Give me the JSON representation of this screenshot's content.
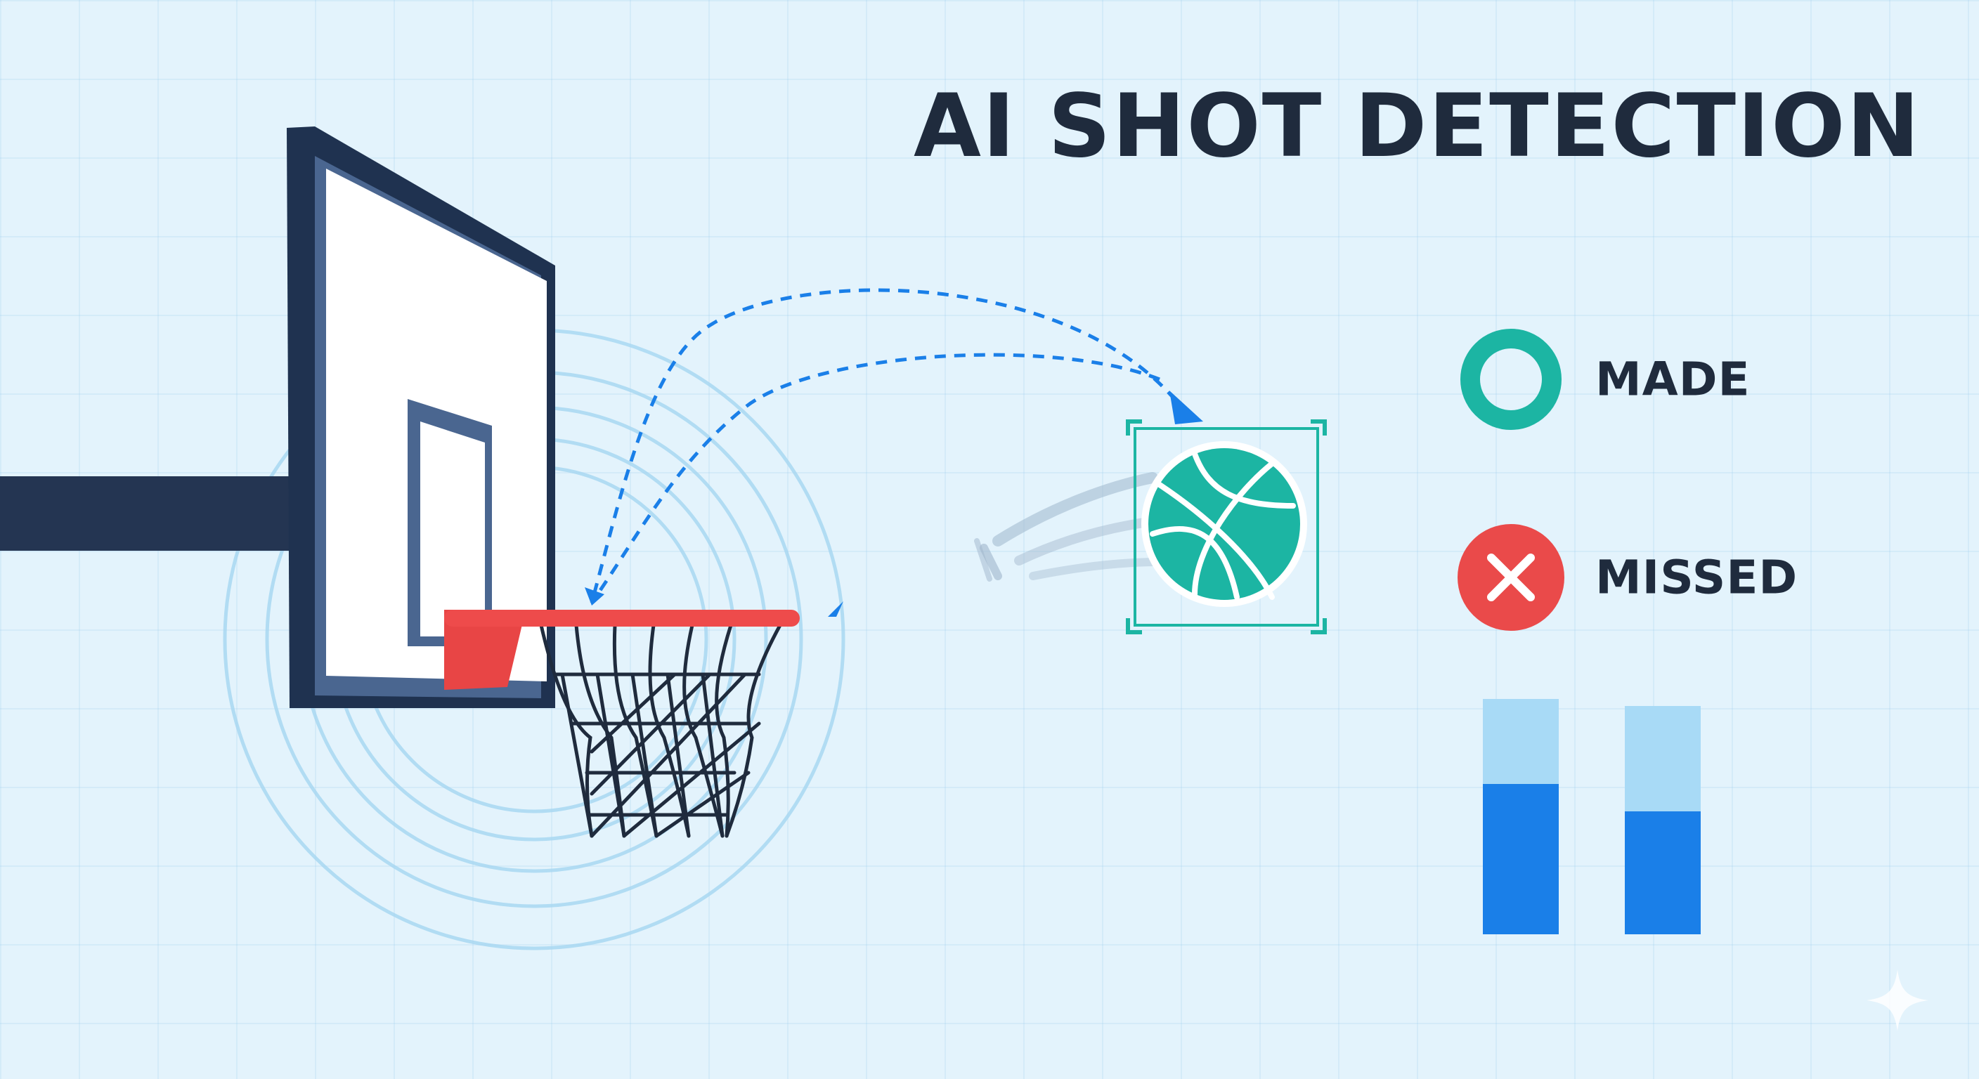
{
  "title": "AI SHOT DETECTION",
  "legend": {
    "made": {
      "label": "MADE",
      "icon": "ring-icon",
      "color": "#1cb5a3"
    },
    "missed": {
      "label": "MISSED",
      "icon": "x-mark-icon",
      "color": "#ea4a4a"
    }
  },
  "stats": {
    "bars": [
      {
        "name": "made-bar",
        "filled_fraction": 0.64
      },
      {
        "name": "missed-bar",
        "filled_fraction": 0.54
      }
    ]
  },
  "colors": {
    "background": "#e3f3fc",
    "navy": "#1f3250",
    "rim": "#ea4a4a",
    "ball": "#1cb5a3",
    "trajectory": "#1a7fe8"
  }
}
